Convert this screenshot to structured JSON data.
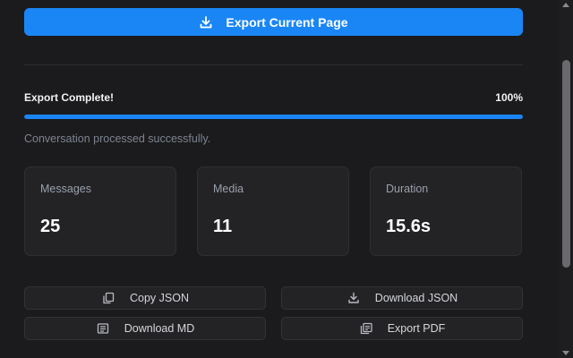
{
  "export_button": {
    "label": "Export Current Page",
    "icon": "download-icon"
  },
  "progress": {
    "label": "Export Complete!",
    "percent_text": "100%",
    "value": 1.0,
    "status": "Conversation processed successfully."
  },
  "stats": [
    {
      "label": "Messages",
      "value": "25"
    },
    {
      "label": "Media",
      "value": "11"
    },
    {
      "label": "Duration",
      "value": "15.6s"
    }
  ],
  "actions": [
    {
      "label": "Copy JSON",
      "icon": "copy-icon"
    },
    {
      "label": "Download JSON",
      "icon": "download-icon"
    },
    {
      "label": "Download MD",
      "icon": "document-icon"
    },
    {
      "label": "Export PDF",
      "icon": "pdf-icon"
    }
  ],
  "colors": {
    "accent": "#1a86f5",
    "background": "#1b1b1d",
    "card": "#232326"
  }
}
